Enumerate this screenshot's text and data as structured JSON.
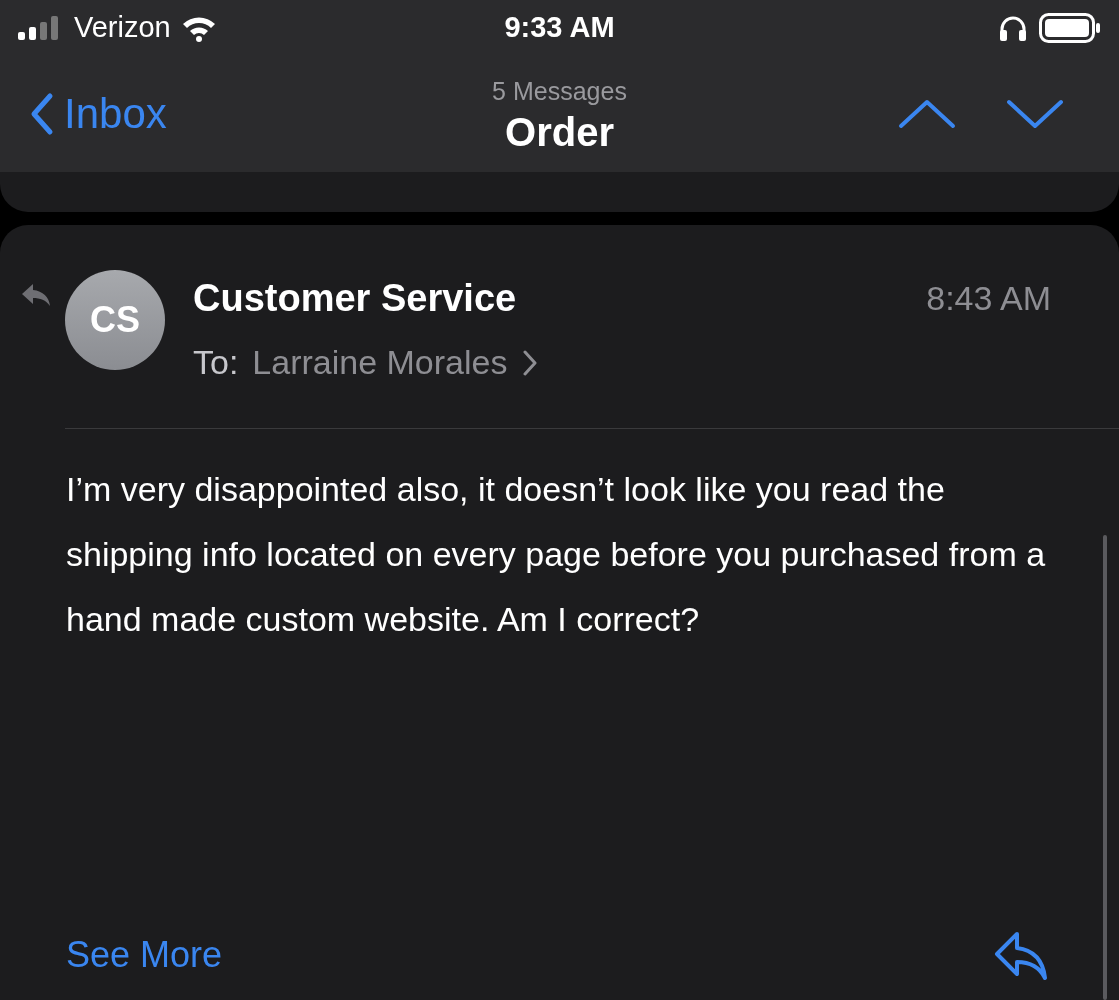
{
  "status_bar": {
    "carrier": "Verizon",
    "time": "9:33 AM"
  },
  "nav": {
    "back_label": "Inbox",
    "subtitle": "5 Messages",
    "title": "Order"
  },
  "message": {
    "avatar_initials": "CS",
    "sender": "Customer Service",
    "time": "8:43 AM",
    "to_label": "To:",
    "recipient": "Larraine Morales",
    "body": "I’m very disappointed also, it doesn’t look like you read the shipping info located on every page before you purchased from a hand made custom website. Am I correct?",
    "see_more": "See More"
  }
}
